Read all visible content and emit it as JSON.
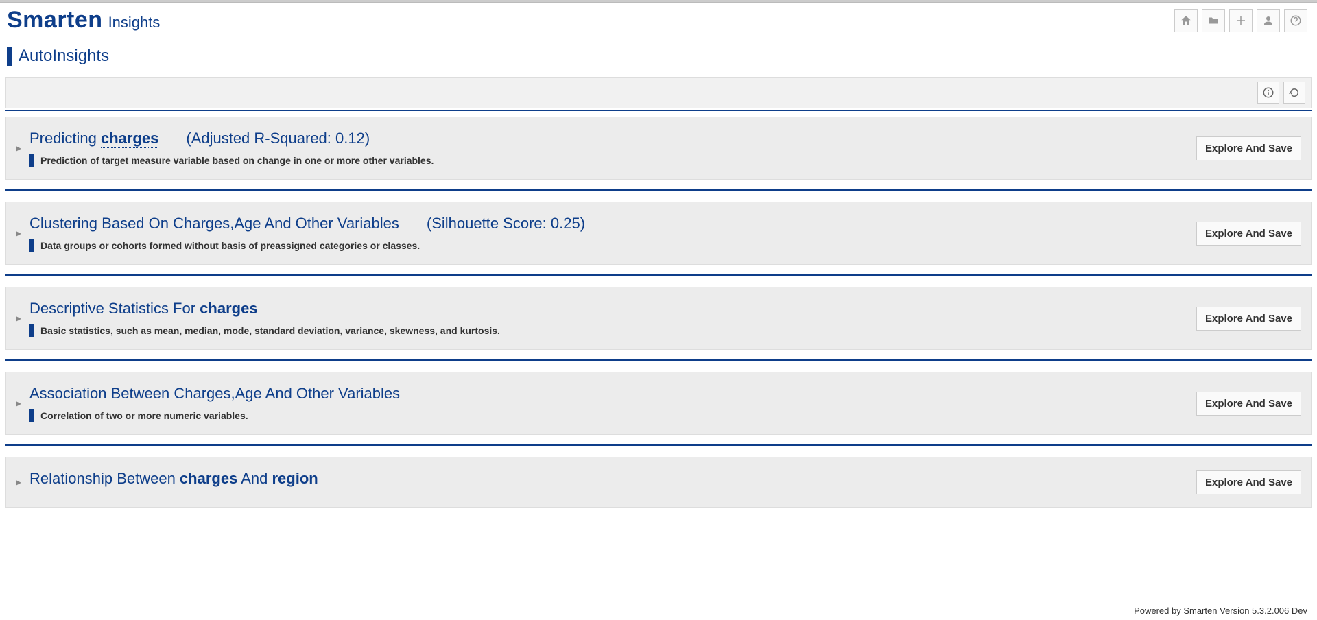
{
  "brand": {
    "main": "Smarten",
    "sub": "Insights"
  },
  "page": {
    "title": "AutoInsights"
  },
  "buttons": {
    "explore": "Explore And Save"
  },
  "cards": [
    {
      "title_parts": [
        {
          "text": "Predicting ",
          "emph": false
        },
        {
          "text": "charges",
          "emph": true
        }
      ],
      "stat": "(Adjusted R-Squared: 0.12)",
      "desc": "Prediction of target measure variable based on change in one or more other variables."
    },
    {
      "title_parts": [
        {
          "text": "Clustering Based On Charges,Age And Other Variables",
          "emph": false
        }
      ],
      "stat": "(Silhouette Score: 0.25)",
      "desc": "Data groups or cohorts formed without basis of preassigned categories or classes."
    },
    {
      "title_parts": [
        {
          "text": "Descriptive Statistics For ",
          "emph": false
        },
        {
          "text": "charges",
          "emph": true
        }
      ],
      "stat": "",
      "desc": "Basic statistics, such as mean, median, mode, standard deviation, variance, skewness, and kurtosis."
    },
    {
      "title_parts": [
        {
          "text": "Association Between Charges,Age And Other Variables",
          "emph": false
        }
      ],
      "stat": "",
      "desc": "Correlation of two or more numeric variables."
    },
    {
      "title_parts": [
        {
          "text": "Relationship Between ",
          "emph": false
        },
        {
          "text": "charges",
          "emph": true
        },
        {
          "text": " And ",
          "emph": false
        },
        {
          "text": "region",
          "emph": true
        }
      ],
      "stat": "",
      "desc": ""
    }
  ],
  "footer": {
    "text": "Powered by Smarten Version 5.3.2.006 Dev"
  }
}
